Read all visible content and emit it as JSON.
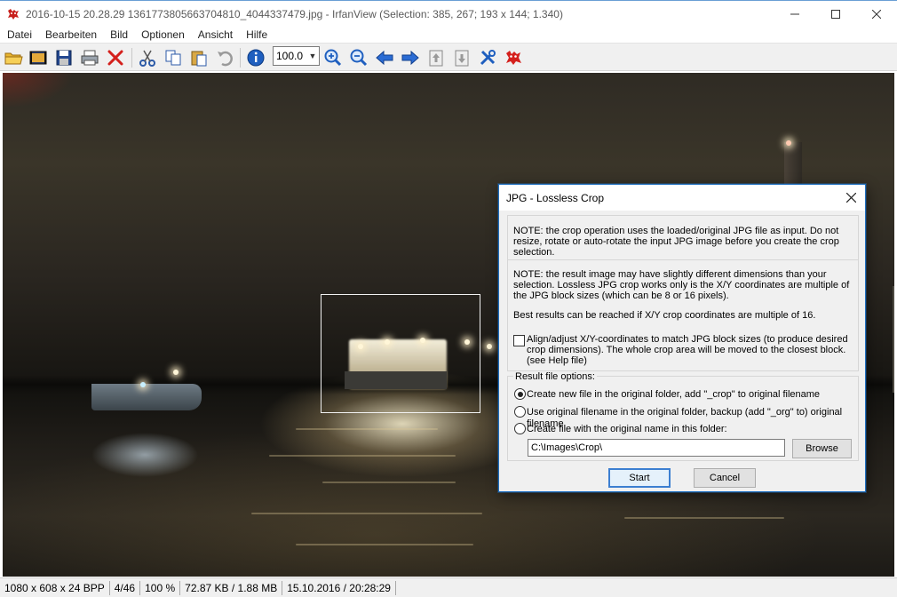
{
  "window": {
    "title": "2016-10-15 20.28.29 1361773805663704810_4044337479.jpg - IrfanView (Selection: 385, 267; 193 x 144; 1.340)",
    "app_icon": "irfanview-cat-icon",
    "controls": [
      "minimize-icon",
      "maximize-icon",
      "close-icon"
    ]
  },
  "menu": [
    "Datei",
    "Bearbeiten",
    "Bild",
    "Optionen",
    "Ansicht",
    "Hilfe"
  ],
  "toolbar": {
    "buttons": [
      "open-folder-icon",
      "slideshow-icon",
      "save-icon",
      "print-icon",
      "delete-icon",
      "cut-icon",
      "copy-icon",
      "paste-icon",
      "undo-icon",
      "info-icon",
      "zoom-in-icon",
      "zoom-out-icon",
      "previous-arrow-icon",
      "next-arrow-icon",
      "first-page-icon",
      "last-page-icon",
      "settings-tools-icon",
      "irfanview-cat-icon"
    ],
    "zoom_value": "100.0"
  },
  "statusbar": {
    "dimensions": "1080 x 608 x 24 BPP",
    "position": "4/46",
    "zoom": "100 %",
    "size": "72.87 KB / 1.88 MB",
    "datetime": "15.10.2016 / 20:28:29"
  },
  "dialog": {
    "title": "JPG - Lossless Crop",
    "note1": "NOTE: the crop operation uses the loaded/original JPG file as input. Do not resize, rotate or auto-rotate the input JPG image before you create the crop selection.",
    "note2": "NOTE: the result image may have slightly different dimensions than your selection. Lossless JPG crop works only is the X/Y coordinates are multiple of the JPG block sizes (which can be 8 or 16 pixels).",
    "note3": "Best results can be reached if X/Y crop coordinates are multiple of 16.",
    "align_label": "Align/adjust X/Y-coordinates to match JPG block sizes (to produce desired crop dimensions). The whole crop area will be moved to the closest block. (see Help file)",
    "align_checked": false,
    "result_heading": "Result file options:",
    "options": [
      "Create new file in the original folder, add \"_crop\" to original filename",
      "Use original filename in the original folder, backup (add \"_org\" to) original filename",
      "Create file with the original name in this folder:"
    ],
    "selected_option": 0,
    "folder_value": "C:\\Images\\Crop\\",
    "browse_label": "Browse",
    "start_label": "Start",
    "cancel_label": "Cancel"
  }
}
